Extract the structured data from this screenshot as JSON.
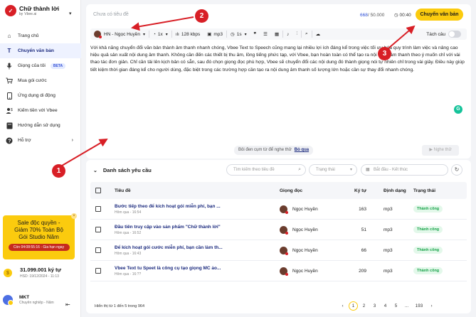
{
  "brand": {
    "title": "Chữ thành lời",
    "by": "by",
    "vbee": "Vbee.ai"
  },
  "sidebar": {
    "items": [
      {
        "label": "Trang chủ",
        "icon": "home-icon"
      },
      {
        "label": "Chuyển văn bản",
        "icon": "text-icon",
        "active": true
      },
      {
        "label": "Giọng của tôi",
        "icon": "microphone-icon",
        "badge": "BETA"
      },
      {
        "label": "Mua gói cước",
        "icon": "cart-icon"
      },
      {
        "label": "Ứng dụng di động",
        "icon": "mobile-icon"
      },
      {
        "label": "Kiếm tiền với Vbee",
        "icon": "money-icon"
      },
      {
        "label": "Hướng dẫn sử dụng",
        "icon": "book-icon"
      },
      {
        "label": "Hỗ trợ",
        "icon": "help-icon"
      }
    ],
    "promo": {
      "line1": "Sale độc quyền -",
      "line2": "Giảm 70% Toàn Bộ",
      "line3": "Gói Studio Năm",
      "cta": "Còn 04:08:55:16 - Gia hạn ngay"
    },
    "chars": {
      "main": "31.099.001 ký tự",
      "expiry": "HSD: 19/12/2024 - 11:13"
    },
    "user": {
      "name": "MKT",
      "plan": "Chuyên nghiệp - Năm"
    }
  },
  "editor": {
    "title_placeholder": "Chưa có tiêu đề",
    "count_current": "668",
    "count_max": "/ 50.000",
    "timer": "00:40",
    "convert_label": "Chuyển văn bản",
    "toolbar": {
      "voice": "HN - Ngọc Huyền",
      "speed": "1x",
      "bitrate": "128 kbps",
      "format": "mp3",
      "pause": "1s",
      "split_label": "Tách câu"
    },
    "body": "Với khả năng chuyển đổi văn bản thành âm thanh nhanh chóng, Vbee Text to Speech cũng mang lại nhiều lợi ích đáng kể trong việc tối ưu hóa quy trình làm việc và nâng cao hiệu quả sản xuất nội dung âm thanh. Không cần đến các thiết bị thu âm, lồng tiếng phức tạp, với Vbee, bạn hoàn toàn có thể tạo ra nội dung âm thanh theo ý muốn chỉ với vài thao tác đơn giản. Chỉ cần tải lên kịch bản có sẵn, sau đó chọn giọng đọc phù hợp, Vbee sẽ chuyển đổi các nội dung đó thành giọng nói tự nhiên chỉ trong vài giây. Điều này giúp tiết kiệm thời gian đáng kể cho người dùng, đặc biệt trong các trường hợp cần tạo ra nội dung âm thanh số lượng lớn hoặc cần sự thay đổi nhanh chóng.",
    "hint": "Bôi đen cụm từ để nghe thử",
    "hint_skip": "Bỏ qua",
    "listen_label": "Nghe thử"
  },
  "requests": {
    "title": "Danh sách yêu cầu",
    "search_placeholder": "Tìm kiếm theo tiêu đề",
    "status_placeholder": "Trạng thái",
    "date_placeholder": "Bắt đầu - Kết thúc",
    "columns": [
      "Tiêu đề",
      "Giọng đọc",
      "Ký tự",
      "Định dạng",
      "Trạng thái"
    ],
    "rows": [
      {
        "title": "Bước tiếp theo để kích hoạt gói miễn phí, bạn ...",
        "time": "Hôm qua - 16:54",
        "voice": "Ngọc Huyền",
        "chars": "163",
        "format": "mp3",
        "status": "Thành công"
      },
      {
        "title": "Đầu tiên truy cập vào sản phẩm \"Chữ thành lời\"",
        "time": "Hôm qua - 16:52",
        "voice": "Ngọc Huyền",
        "chars": "51",
        "format": "mp3",
        "status": "Thành công"
      },
      {
        "title": "Để kích hoạt gói cước miễn phí, bạn cần làm th...",
        "time": "Hôm qua - 16:43",
        "voice": "Ngọc Huyền",
        "chars": "66",
        "format": "mp3",
        "status": "Thành công"
      },
      {
        "title": "Vbee Text tu Speet là công cụ tạo giọng MC ảo...",
        "time": "Hôm qua - 16:??",
        "voice": "Ngọc Huyền",
        "chars": "209",
        "format": "mp3",
        "status": "Thành công"
      }
    ],
    "footer": "Hiển thị từ 1 đến 5 trong 964",
    "pages": [
      "‹",
      "1",
      "2",
      "3",
      "4",
      "5",
      "...",
      "193",
      "›"
    ]
  },
  "annotations": [
    "1",
    "2",
    "3"
  ],
  "colors": {
    "accent": "#fbcb0e",
    "brand_red": "#d81f26",
    "primary_text": "#1b2a7e",
    "success": "#19a34a"
  }
}
